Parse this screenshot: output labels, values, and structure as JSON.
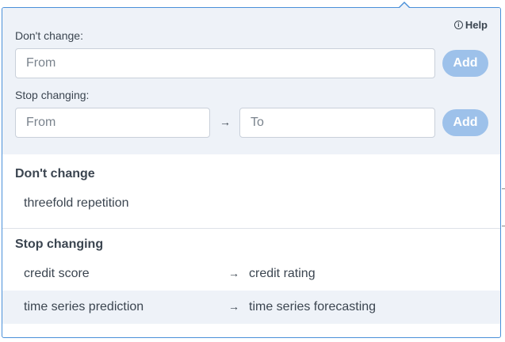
{
  "help": {
    "label": "Help",
    "icon": "info-icon"
  },
  "dont_change_form": {
    "label": "Don't change:",
    "from_placeholder": "From",
    "add_label": "Add"
  },
  "stop_changing_form": {
    "label": "Stop changing:",
    "from_placeholder": "From",
    "to_placeholder": "To",
    "arrow": "→",
    "add_label": "Add"
  },
  "dont_change_list": {
    "title": "Don't change",
    "items": [
      "threefold repetition"
    ]
  },
  "stop_changing_list": {
    "title": "Stop changing",
    "items": [
      {
        "from": "credit score",
        "arrow": "→",
        "to": "credit rating"
      },
      {
        "from": "time series prediction",
        "arrow": "→",
        "to": "time series forecasting"
      }
    ]
  },
  "colors": {
    "accent": "#4a90d9",
    "button": "#9dc1ea",
    "panel_bg": "#eef2f8"
  }
}
